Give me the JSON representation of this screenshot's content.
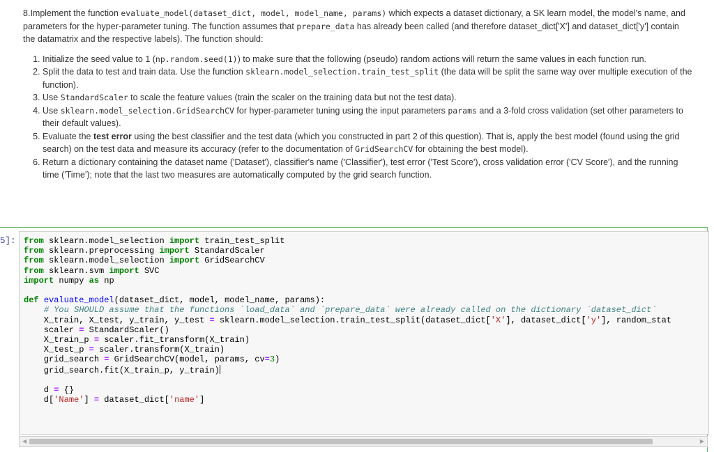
{
  "intro": {
    "number": "8.",
    "text_a": "Implement the function ",
    "code_a": "evaluate_model(dataset_dict, model, model_name, params)",
    "text_b": " which expects a dataset dictionary, a SK learn model, the model's name, and parameters for the hyper-parameter tuning. The function assumes that ",
    "code_b": "prepare_data",
    "text_c": " has already been called (and therefore dataset_dict['X'] and dataset_dict['y'] contain the datamatrix and the respective labels). The function should:"
  },
  "steps": [
    {
      "t1": "Initialize the seed value to 1 (",
      "c1": "np.random.seed(1)",
      "t2": ") to make sure that the following (pseudo) random actions will return the same values in each function run."
    },
    {
      "t1": "Split the data to test and train data. Use the function ",
      "c1": "sklearn.model_selection.train_test_split",
      "t2": " (the data will be split the same way over multiple execution of the function)."
    },
    {
      "t1": "Use ",
      "c1": "StandardScaler",
      "t2": " to scale the feature values (train the scaler on the training data but not the test data)."
    },
    {
      "t1": "Use ",
      "c1": "sklearn.model_selection.GridSearchCV",
      "t2": " for hyper-parameter tuning using the input parameters ",
      "c2": "params",
      "t3": " and a 3-fold cross validation (set other parameters to their default values)."
    },
    {
      "t1": "Evaluate the ",
      "b1": "test error",
      "t2": " using the best classifier and the test data (which you constructed in part 2 of this question). That is, apply the best model (found using the grid search) on the test data and measure its accuracy (refer to the documentation of ",
      "c1": "GridSearchCV",
      "t3": " for obtaining the best model)."
    },
    {
      "t1": "Return a dictionary containing the dataset name ('Dataset'), classifier's name ('Classifier'), test error ('Test Score'), cross validation error ('CV Score'), and the running time ('Time'); note that the last two measures are automatically computed by the grid search function."
    }
  ],
  "cell": {
    "prompt": "5]:",
    "lines": [
      "from sklearn.model_selection import train_test_split",
      "from sklearn.preprocessing import StandardScaler",
      "from sklearn.model_selection import GridSearchCV",
      "from sklearn.svm import SVC",
      "import numpy as np",
      "",
      "def evaluate_model(dataset_dict, model, model_name, params):",
      "    # You SHOULD assume that the functions `load_data` and `prepare_data` were already called on the dictionary `dataset_dict`",
      "    X_train, X_test, y_train, y_test = sklearn.model_selection.train_test_split(dataset_dict['X'], dataset_dict['y'], random_stat",
      "    scaler = StandardScaler()",
      "    X_train_p = scaler.fit_transform(X_train)",
      "    X_test_p = scaler.transform(X_train)",
      "    grid_search = GridSearchCV(model, params, cv=3)",
      "    grid_search.fit(X_train_p, y_train)",
      "",
      "    d = {}",
      "    d['Name'] = dataset_dict['name']"
    ]
  },
  "icons": {
    "left_arrow": "scroll-left-arrow",
    "right_arrow": "scroll-right-arrow"
  },
  "colors": {
    "cell_border": "#66bb6a",
    "prompt": "#303f9f",
    "keyword": "#008000",
    "function": "#0000ff",
    "string": "#ba2121",
    "comment": "#408080"
  }
}
